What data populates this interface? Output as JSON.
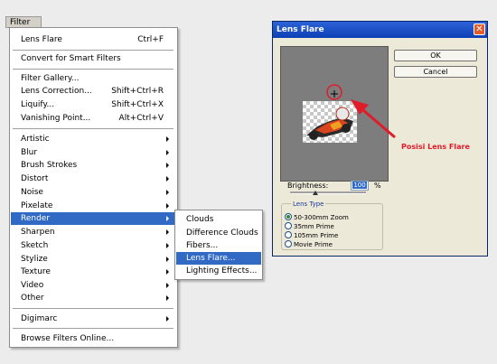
{
  "menubar": {
    "filter_label": "Filter"
  },
  "filter_menu": {
    "items": [
      {
        "label": "Lens Flare",
        "shortcut": "Ctrl+F"
      },
      {
        "label": "Convert for Smart Filters"
      },
      {
        "label": "Filter Gallery..."
      },
      {
        "label": "Lens Correction...",
        "shortcut": "Shift+Ctrl+R"
      },
      {
        "label": "Liquify...",
        "shortcut": "Shift+Ctrl+X"
      },
      {
        "label": "Vanishing Point...",
        "shortcut": "Alt+Ctrl+V"
      },
      {
        "label": "Artistic"
      },
      {
        "label": "Blur"
      },
      {
        "label": "Brush Strokes"
      },
      {
        "label": "Distort"
      },
      {
        "label": "Noise"
      },
      {
        "label": "Pixelate"
      },
      {
        "label": "Render"
      },
      {
        "label": "Sharpen"
      },
      {
        "label": "Sketch"
      },
      {
        "label": "Stylize"
      },
      {
        "label": "Texture"
      },
      {
        "label": "Video"
      },
      {
        "label": "Other"
      },
      {
        "label": "Digimarc"
      },
      {
        "label": "Browse Filters Online..."
      }
    ]
  },
  "render_submenu": {
    "items": [
      {
        "label": "Clouds"
      },
      {
        "label": "Difference Clouds"
      },
      {
        "label": "Fibers..."
      },
      {
        "label": "Lens Flare..."
      },
      {
        "label": "Lighting Effects..."
      }
    ]
  },
  "dialog": {
    "title": "Lens Flare",
    "close_glyph": "✕",
    "ok_label": "OK",
    "cancel_label": "Cancel",
    "brightness_label": "Brightness:",
    "brightness_value": "100",
    "percent": "%",
    "lens_type_label": "Lens Type",
    "lens_options": [
      {
        "label": "50-300mm Zoom",
        "selected": true
      },
      {
        "label": "35mm Prime",
        "selected": false
      },
      {
        "label": "105mm Prime",
        "selected": false
      },
      {
        "label": "Movie Prime",
        "selected": false
      }
    ]
  },
  "annotation": {
    "text": "Posisi Lens Flare",
    "color": "#e01b2a"
  },
  "colors": {
    "highlight": "#316ac5",
    "title_bar": "#0e3fb4"
  }
}
